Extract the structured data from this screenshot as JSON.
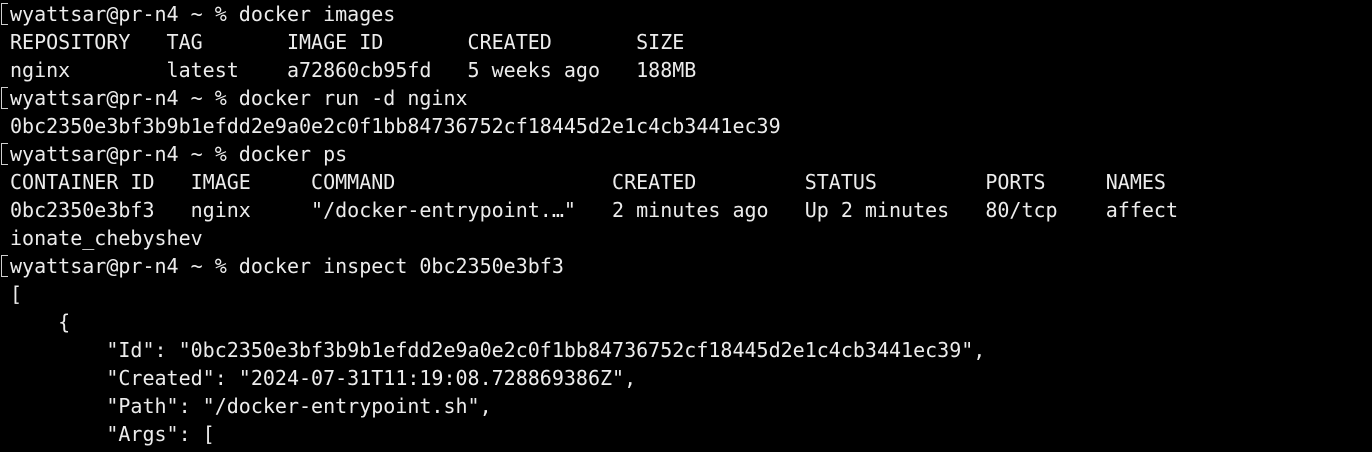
{
  "terminal": {
    "colors": {
      "background": "#000000",
      "foreground": "#ececec",
      "prompt_marker": "#cfcfcf"
    },
    "lines": [
      "wyattsar@pr-n4 ~ % docker images",
      "REPOSITORY   TAG       IMAGE ID       CREATED       SIZE",
      "nginx        latest    a72860cb95fd   5 weeks ago   188MB",
      "wyattsar@pr-n4 ~ % docker run -d nginx",
      "0bc2350e3bf3b9b1efdd2e9a0e2c0f1bb84736752cf18445d2e1c4cb3441ec39",
      "wyattsar@pr-n4 ~ % docker ps",
      "CONTAINER ID   IMAGE     COMMAND                  CREATED         STATUS         PORTS     NAMES",
      "0bc2350e3bf3   nginx     \"/docker-entrypoint.…\"   2 minutes ago   Up 2 minutes   80/tcp    affect",
      "ionate_chebyshev",
      "wyattsar@pr-n4 ~ % docker inspect 0bc2350e3bf3",
      "[",
      "    {",
      "        \"Id\": \"0bc2350e3bf3b9b1efdd2e9a0e2c0f1bb84736752cf18445d2e1c4cb3441ec39\",",
      "        \"Created\": \"2024-07-31T11:19:08.728869386Z\",",
      "        \"Path\": \"/docker-entrypoint.sh\",",
      "        \"Args\": ["
    ]
  }
}
